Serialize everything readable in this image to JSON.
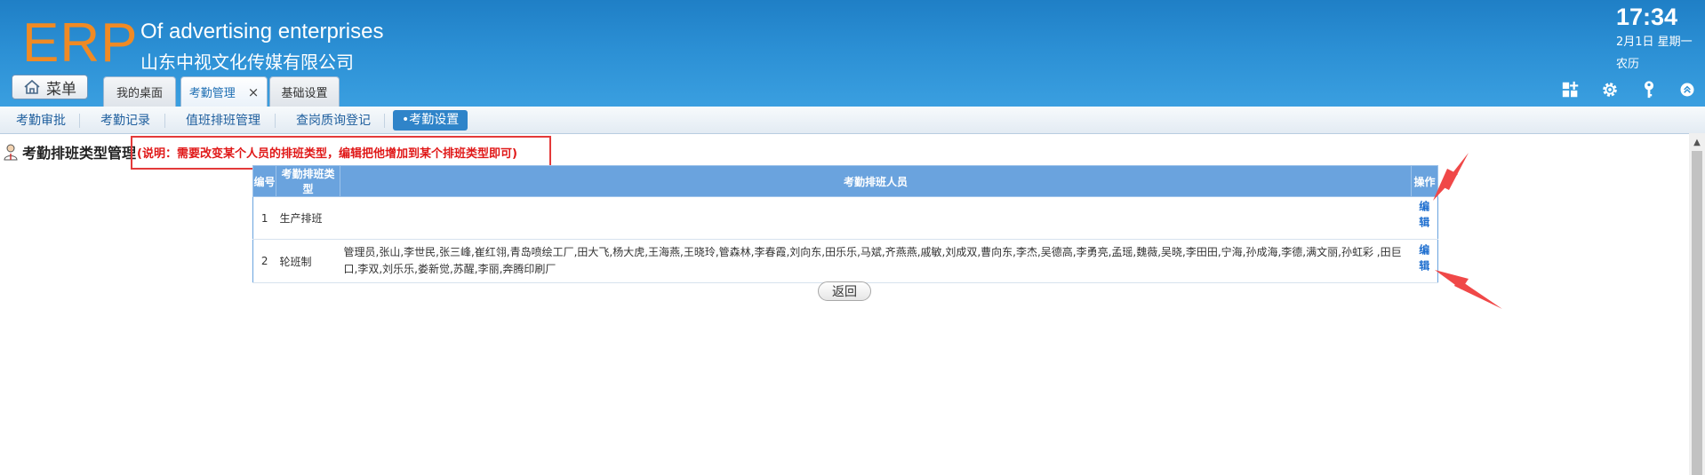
{
  "header": {
    "logo": "ERP",
    "title_en": "Of advertising enterprises",
    "title_cn": "山东中视文化传媒有限公司",
    "clock": "17:34",
    "date": "2月1日 星期一",
    "lunar": "农历",
    "menu_label": "菜单",
    "tabs": [
      {
        "label": "我的桌面"
      },
      {
        "label": "考勤管理",
        "close": "×"
      },
      {
        "label": "基础设置"
      }
    ],
    "icons": [
      "apps-icon",
      "gear-icon",
      "key-icon",
      "collapse-icon"
    ]
  },
  "subnav": {
    "items": [
      {
        "label": "考勤审批"
      },
      {
        "label": "考勤记录"
      },
      {
        "label": "值班排班管理"
      },
      {
        "label": "查岗质询登记"
      },
      {
        "label": "•考勤设置"
      }
    ]
  },
  "content": {
    "page_title": "考勤排班类型管理",
    "note": "(说明：需要改变某个人员的排班类型，编辑把他增加到某个排班类型即可)",
    "table": {
      "headers": [
        "编号",
        "考勤排班类型",
        "考勤排班人员",
        "操作"
      ],
      "rows": [
        {
          "id": "1",
          "type": "生产排班",
          "members": "",
          "action": "编辑"
        },
        {
          "id": "2",
          "type": "轮班制",
          "members": "管理员,张山,李世民,张三峰,崔红翎,青岛喷绘工厂,田大飞,杨大虎,王海燕,王晓玲,管森林,李春霞,刘向东,田乐乐,马斌,齐燕燕,戚敏,刘成双,曹向东,李杰,吴德高,李勇亮,孟瑶,魏薇,吴晓,李田田,宁海,孙成海,李德,满文丽,孙虹彩 ,田巨口,李双,刘乐乐,娄新觉,苏醒,李丽,奔腾印刷厂",
          "action": "编辑"
        }
      ]
    },
    "back_label": "返回"
  },
  "colors": {
    "header_bg": "#2b8fd4",
    "logo": "#f08a24",
    "table_header": "#6aa3de",
    "note_red": "#e01818",
    "link_blue": "#1f6fcf"
  }
}
